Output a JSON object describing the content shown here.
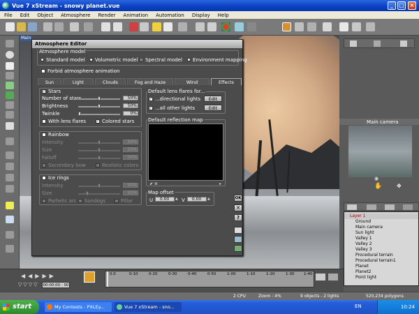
{
  "window": {
    "title": "Vue 7 xStream - snowy planet.vue",
    "min": "_",
    "max": "□",
    "close": "×"
  },
  "menu": [
    "File",
    "Edit",
    "Object",
    "Atmosphere",
    "Render",
    "Animation",
    "Automation",
    "Display",
    "Help"
  ],
  "viewport": {
    "label": "Main"
  },
  "editor": {
    "title": "Atmosphere Editor",
    "model_group": "Atmosphere model",
    "models": [
      "Standard model",
      "Volumetric model",
      "Spectral model",
      "Environment mapping"
    ],
    "selected_model": "Spectral model",
    "forbid_anim": "Forbid atmosphere animation",
    "tabs": [
      "Sun",
      "Light",
      "Clouds",
      "Fog and Haze",
      "Wind",
      "Effects"
    ],
    "active_tab": "Effects",
    "stars": {
      "label": "Stars",
      "number_label": "Number of stars",
      "number_value": "50%",
      "brightness_label": "Brightness",
      "brightness_value": "50%",
      "twinkle_label": "Twinkle",
      "twinkle_value": "0%",
      "lens_flares": "With lens flares",
      "colored": "Colored stars"
    },
    "rainbow": {
      "label": "Rainbow",
      "intensity_label": "Intensity",
      "intensity_value": "50%",
      "size_label": "Size",
      "size_value": "50%",
      "falloff_label": "Falloff",
      "falloff_value": "50%",
      "secondary": "Secondary bow",
      "realistic": "Realistic colors"
    },
    "ice": {
      "label": "Ice rings",
      "intensity_label": "Intensity",
      "intensity_value": "50%",
      "size_label": "Size",
      "size_value": "20%",
      "parhelic": "Parhelic arc",
      "sundogs": "Sundogs",
      "pillar": "Pillar"
    },
    "lens": {
      "label": "Default lens flares for...",
      "directional": "...directional lights",
      "other": "...all other lights",
      "edit": "Edit"
    },
    "reflection": {
      "label": "Default reflection map"
    },
    "offset": {
      "label": "Map offset",
      "u_label": "U",
      "u_value": "0.00",
      "v_label": "V",
      "v_value": "0.00"
    },
    "side": {
      "ok": "OK",
      "cancel": "✕",
      "help": "?"
    }
  },
  "camera": {
    "label": "Main camera"
  },
  "scene": {
    "items": [
      "Layer 1",
      "Ground",
      "Main camera",
      "Sun light",
      "Valley 1",
      "Valley 2",
      "Valley 3",
      "Procedural terrain",
      "Procedural terrain1",
      "Planet",
      "Planet2",
      "Point light"
    ]
  },
  "timeline": {
    "time": "00:00:00 : 00",
    "ticks": [
      "0.0",
      "0-10",
      "0-20",
      "0-30",
      "0-40",
      "0-50",
      "1-00",
      "1-10",
      "1-20",
      "1-30",
      "1-40"
    ]
  },
  "status": {
    "cpu": "2 CPU",
    "zoom": "Zoom : 4%",
    "objects": "9 objects - 2 lights",
    "polygons": "520,234 polygons"
  },
  "taskbar": {
    "start": "start",
    "tasks": [
      "My Contests - PXLEy...",
      "Vue 7 xStream - sno..."
    ],
    "lang": "EN",
    "clock": "10:24"
  }
}
